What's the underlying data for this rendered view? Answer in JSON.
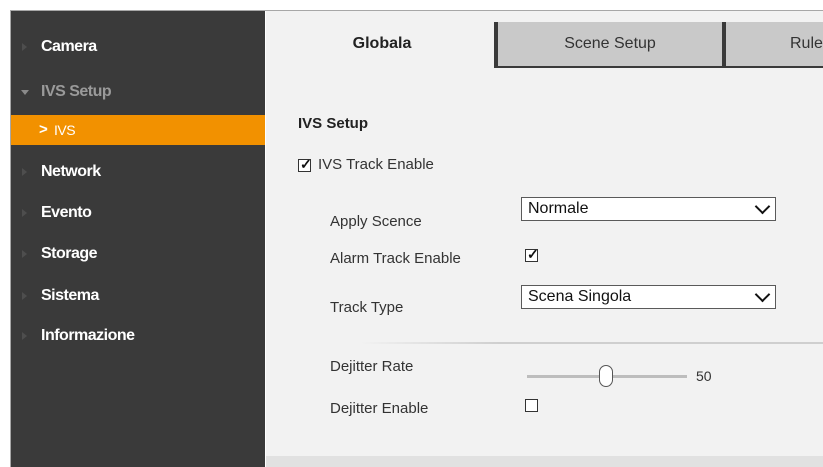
{
  "sidebar": {
    "items": [
      {
        "label": "Camera",
        "state": "normal"
      },
      {
        "label": "IVS Setup",
        "state": "expanded"
      },
      {
        "label": "IVS",
        "state": "active"
      },
      {
        "label": "Network",
        "state": "normal"
      },
      {
        "label": "Evento",
        "state": "normal"
      },
      {
        "label": "Storage",
        "state": "normal"
      },
      {
        "label": "Sistema",
        "state": "normal"
      },
      {
        "label": "Informazione",
        "state": "normal"
      }
    ],
    "active_chevron": ">"
  },
  "tabs": [
    {
      "label": "Globala",
      "active": true
    },
    {
      "label": "Scene Setup",
      "active": false
    },
    {
      "label": "Rule",
      "active": false
    }
  ],
  "section": {
    "title": "IVS Setup"
  },
  "form": {
    "ivs_track_enable": {
      "label": "IVS Track Enable",
      "checked": true
    },
    "apply_scence": {
      "label": "Apply Scence",
      "value": "Normale"
    },
    "alarm_track_enable": {
      "label": "Alarm Track Enable",
      "checked": true
    },
    "track_type": {
      "label": "Track Type",
      "value": "Scena Singola"
    },
    "dejitter_rate": {
      "label": "Dejitter Rate",
      "value": "50"
    },
    "dejitter_enable": {
      "label": "Dejitter Enable",
      "checked": false
    },
    "check_mark": "✓"
  },
  "colors": {
    "sidebar_bg": "#3a3a3a",
    "active_item": "#f29100",
    "content_bg": "#f2f2f2",
    "inactive_tab": "#c9c9c9"
  }
}
